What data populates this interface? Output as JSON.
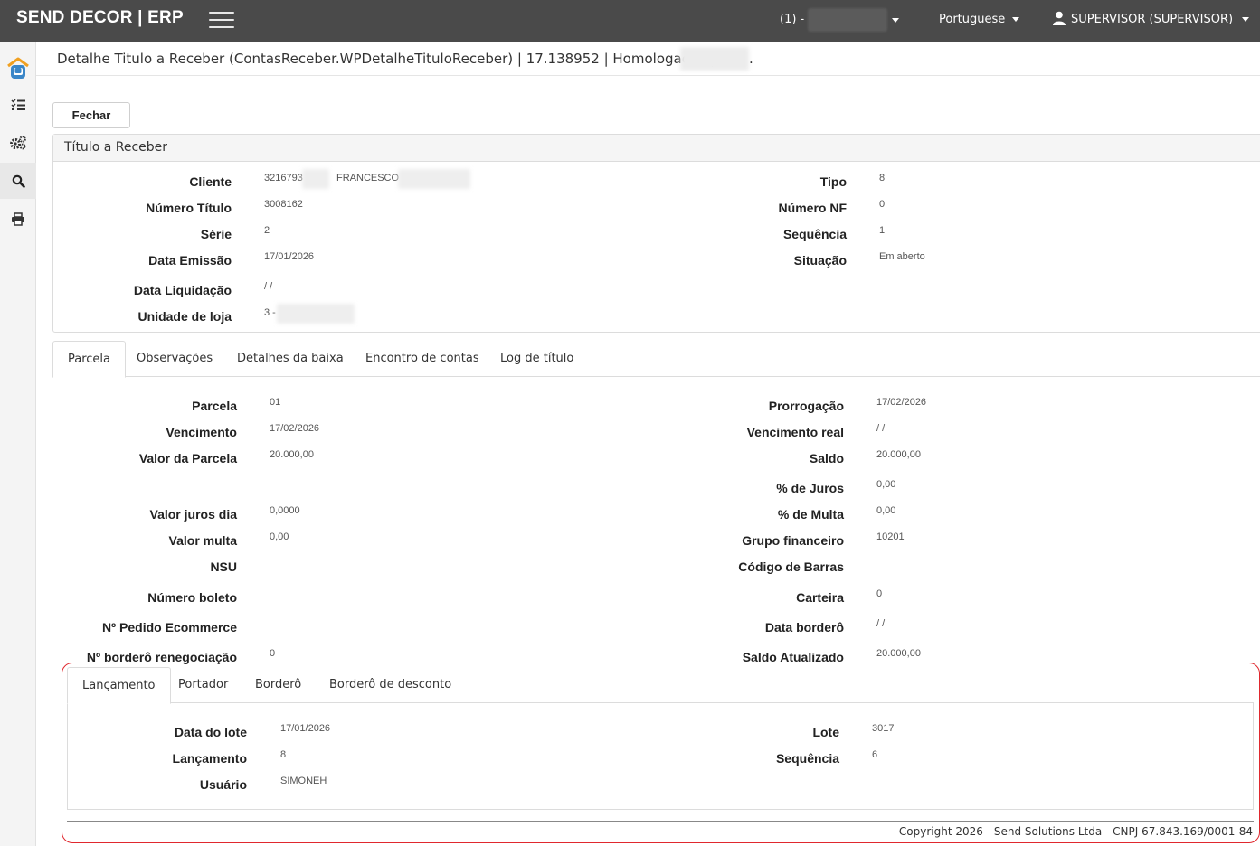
{
  "topbar": {
    "brand": "SEND DECOR | ERP",
    "company_prefix": "(1) -",
    "language": "Portuguese",
    "user": "SUPERVISOR (SUPERVISOR)"
  },
  "sidebar": {
    "items": [
      {
        "icon": "home-icon"
      },
      {
        "icon": "task-list-icon"
      },
      {
        "icon": "gears-icon"
      },
      {
        "icon": "search-icon"
      },
      {
        "icon": "print-icon"
      }
    ]
  },
  "header": {
    "title": "Detalhe Titulo a Receber (ContasReceber.WPDetalheTituloReceber) | 17.138952 | Homologação |",
    "trailing": "."
  },
  "actions": {
    "close_label": "Fechar"
  },
  "titulo_panel": {
    "heading": "Título a Receber",
    "left": [
      {
        "label": "Cliente",
        "value": "3216793",
        "extra": "FRANCESCO"
      },
      {
        "label": "Número Título",
        "value": "3008162"
      },
      {
        "label": "Série",
        "value": "2"
      },
      {
        "label": "Data Emissão",
        "value": "17/01/2026"
      },
      {
        "label": "Data Liquidação",
        "value": "/ /"
      },
      {
        "label": "Unidade de loja",
        "value": "3 -"
      }
    ],
    "right": [
      {
        "label": "Tipo",
        "value": "8"
      },
      {
        "label": "Número NF",
        "value": "0"
      },
      {
        "label": "Sequência",
        "value": "1"
      },
      {
        "label": "Situação",
        "value": "Em aberto"
      }
    ]
  },
  "tabs_main": [
    "Parcela",
    "Observações",
    "Detalhes da baixa",
    "Encontro de contas",
    "Log de título"
  ],
  "parcela": {
    "left": [
      {
        "label": "Parcela",
        "value": "01"
      },
      {
        "label": "Vencimento",
        "value": "17/02/2026"
      },
      {
        "label": "Valor da Parcela",
        "value": "20.000,00"
      },
      {
        "label": "Valor juros dia",
        "value": "0,0000"
      },
      {
        "label": "Valor multa",
        "value": "0,00"
      },
      {
        "label": "NSU",
        "value": ""
      },
      {
        "label": "Número boleto",
        "value": ""
      },
      {
        "label": "Nº Pedido Ecommerce",
        "value": ""
      },
      {
        "label": "Nº borderô renegociação",
        "value": "0"
      }
    ],
    "right": [
      {
        "label": "Prorrogação",
        "value": "17/02/2026"
      },
      {
        "label": "Vencimento real",
        "value": "/ /"
      },
      {
        "label": "Saldo",
        "value": "20.000,00"
      },
      {
        "label": "% de Juros",
        "value": "0,00"
      },
      {
        "label": "% de Multa",
        "value": "0,00"
      },
      {
        "label": "Grupo financeiro",
        "value": "10201"
      },
      {
        "label": "Código de Barras",
        "value": ""
      },
      {
        "label": "Carteira",
        "value": "0"
      },
      {
        "label": "Data borderô",
        "value": "/ /"
      },
      {
        "label": "Saldo Atualizado",
        "value": "20.000,00"
      }
    ]
  },
  "tabs_sub": [
    "Lançamento",
    "Portador",
    "Borderô",
    "Borderô de desconto"
  ],
  "lancamento": {
    "left": [
      {
        "label": "Data do lote",
        "value": "17/01/2026"
      },
      {
        "label": "Lançamento",
        "value": "8"
      },
      {
        "label": "Usuário",
        "value": "SIMONEH"
      }
    ],
    "right": [
      {
        "label": "Lote",
        "value": "3017"
      },
      {
        "label": "Sequência",
        "value": "6"
      }
    ]
  },
  "footer": {
    "copyright": "Copyright 2026 - Send Solutions Ltda - CNPJ 67.843.169/0001-84"
  },
  "colors": {
    "topbar": "#4a4a4a",
    "highlight": "#e0282e",
    "home_icon": "#3a86c8"
  }
}
